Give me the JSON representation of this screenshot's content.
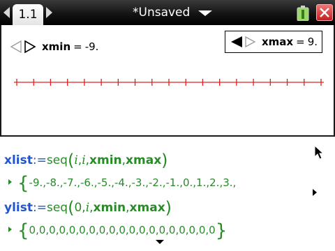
{
  "window": {
    "active_tab": "1.1",
    "doc_title": "*Unsaved",
    "colors": {
      "bar": "#1a1a1a",
      "close": "#d23030",
      "definition": "#2255cc",
      "expression": "#2a8a2a",
      "number_line": "#e02020"
    }
  },
  "graph": {
    "xmin": {
      "label": "xmin",
      "eq": "=",
      "value": "-9."
    },
    "xmax": {
      "label": "xmax",
      "eq": "=",
      "value": "9."
    },
    "number_line": {
      "from": -9,
      "to": 9,
      "step": 1
    }
  },
  "calculator": {
    "xlist": {
      "name": "xlist",
      "assign": ":=",
      "fn": "seq",
      "args": [
        "i",
        "i",
        "xmin",
        "xmax"
      ],
      "result": "-9.,-8.,-7.,-6.,-5.,-4.,-3.,-2.,-1.,0.,1.,2.,3.,"
    },
    "ylist": {
      "name": "ylist",
      "assign": ":=",
      "fn": "seq",
      "args": [
        "0",
        "i",
        "xmin",
        "xmax"
      ],
      "result": "0,0,0,0,0,0,0,0,0,0,0,0,0,0,0,0,0,0,0"
    }
  },
  "icons": [
    "tab-prev-icon",
    "tab-next-icon",
    "title-dropdown-icon",
    "battery-icon",
    "close-icon",
    "slider-left-icon",
    "slider-right-icon",
    "mouse-pointer-icon",
    "scroll-right-icon",
    "scroll-down-icon"
  ]
}
